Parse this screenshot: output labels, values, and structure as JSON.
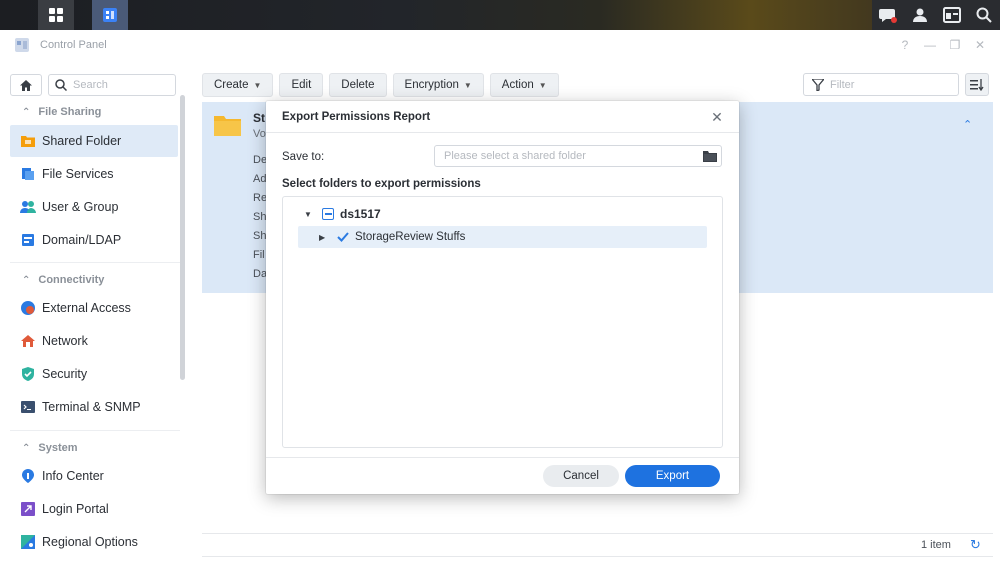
{
  "window": {
    "title": "Control Panel"
  },
  "sidebar": {
    "search_placeholder": "Search",
    "sections": {
      "file_sharing": "File Sharing",
      "connectivity": "Connectivity",
      "system": "System"
    },
    "items": {
      "shared_folder": "Shared Folder",
      "file_services": "File Services",
      "user_group": "User & Group",
      "domain_ldap": "Domain/LDAP",
      "external_access": "External Access",
      "network": "Network",
      "security": "Security",
      "terminal_snmp": "Terminal & SNMP",
      "info_center": "Info Center",
      "login_portal": "Login Portal",
      "regional_options": "Regional Options"
    }
  },
  "toolbar": {
    "create": "Create",
    "edit": "Edit",
    "delete": "Delete",
    "encryption": "Encryption",
    "action": "Action",
    "filter_placeholder": "Filter"
  },
  "row": {
    "name": "St",
    "sub": "Vo",
    "attrs": [
      "De",
      "Ad",
      "Re",
      "Sh",
      "Sh",
      "Fil",
      "Da"
    ]
  },
  "status": {
    "count": "1 item"
  },
  "modal": {
    "title": "Export Permissions Report",
    "save_to_label": "Save to:",
    "save_to_placeholder": "Please select a shared folder",
    "select_label": "Select folders to export permissions",
    "tree": {
      "root": "ds1517",
      "child": "StorageReview Stuffs"
    },
    "cancel": "Cancel",
    "export": "Export"
  },
  "colors": {
    "accent": "#1e72e0",
    "selection": "#dbe8f7"
  }
}
